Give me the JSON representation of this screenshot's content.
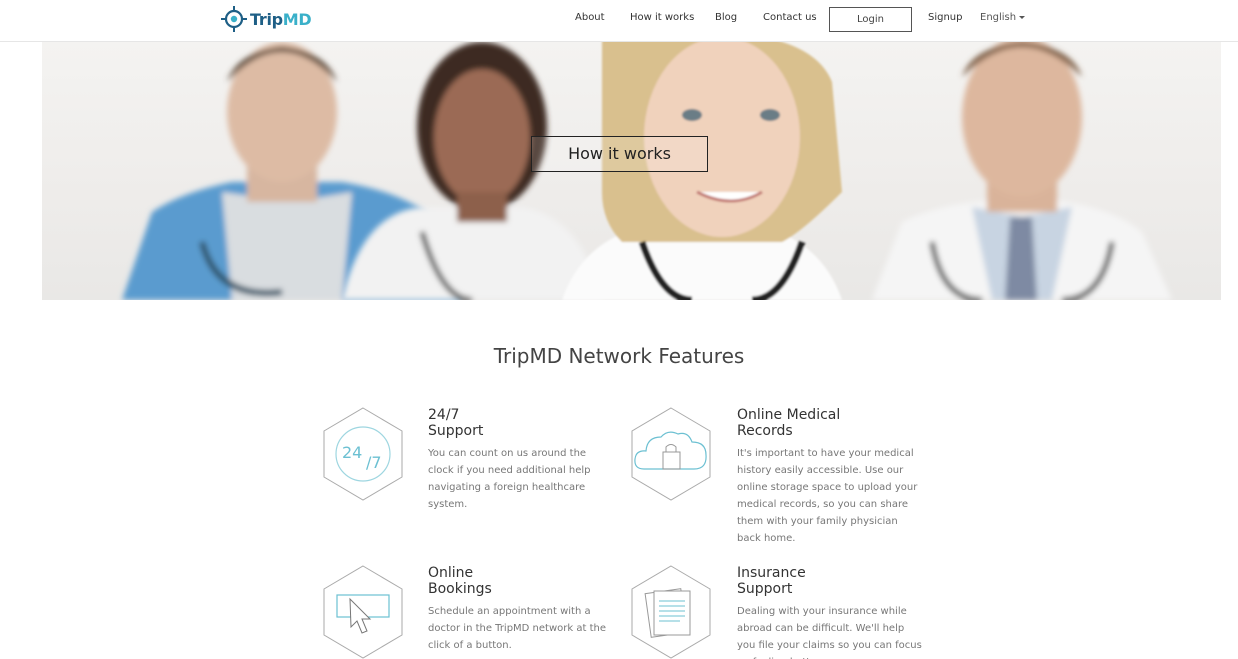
{
  "brand": {
    "name_part1": "Trip",
    "name_part2": "MD",
    "colors": {
      "dark": "#1e5f86",
      "light": "#3ab0c9"
    }
  },
  "nav": {
    "items": [
      {
        "label": "About"
      },
      {
        "label": "How it works"
      },
      {
        "label": "Blog"
      },
      {
        "label": "Contact us"
      }
    ],
    "login_label": "Login",
    "signup_label": "Signup",
    "language": "English"
  },
  "hero": {
    "button_label": "How it works"
  },
  "features": {
    "title": "TripMD Network Features",
    "items": [
      {
        "icon": "24-7-icon",
        "heading_line1": "24/7",
        "heading_line2": "Support",
        "icon_text_1": "24",
        "icon_text_2": "/7",
        "description": "You can count on us around the clock if you need additional help navigating a foreign healthcare system."
      },
      {
        "icon": "cloud-lock-icon",
        "heading_line1": "Online Medical",
        "heading_line2": "Records",
        "description": "It's important to have your medical history easily accessible. Use our online storage space to upload your medical records, so you can share them with your family physician back home."
      },
      {
        "icon": "cursor-click-icon",
        "heading_line1": "Online",
        "heading_line2": "Bookings",
        "description": "Schedule an appointment with a doctor in the TripMD network at the click of a button."
      },
      {
        "icon": "documents-icon",
        "heading_line1": "Insurance",
        "heading_line2": "Support",
        "description": "Dealing with your insurance while abroad can be difficult. We'll help you file your claims so you can focus on feeling better."
      }
    ]
  }
}
